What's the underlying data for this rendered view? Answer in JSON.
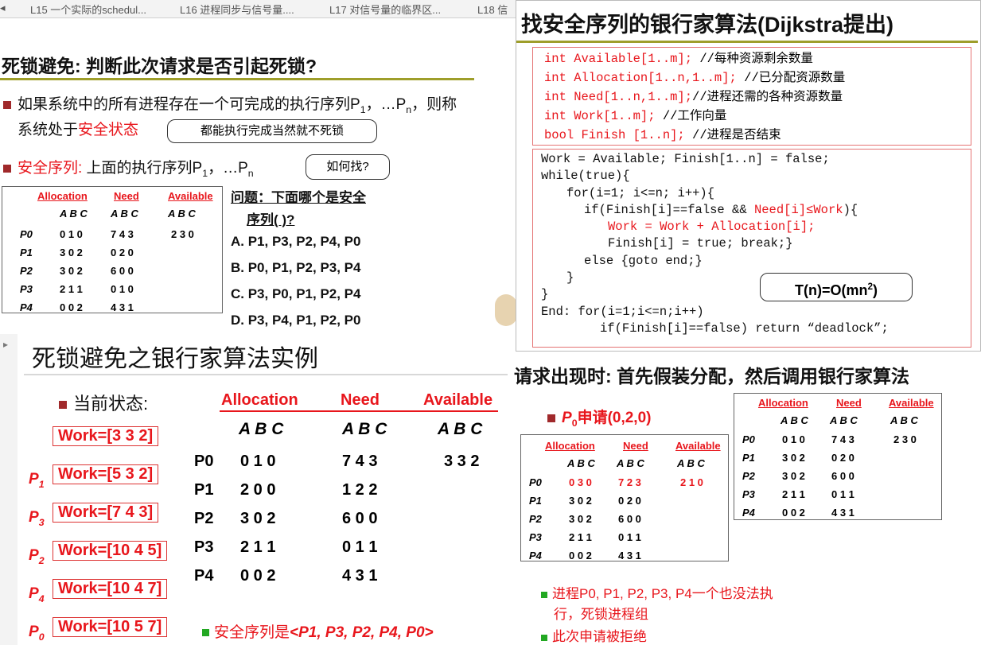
{
  "tabs": [
    {
      "label": "L15 一个实际的schedul..."
    },
    {
      "label": "L16 进程同步与信号量...."
    },
    {
      "label": "L17 对信号量的临界区..."
    },
    {
      "label": "L18 信"
    }
  ],
  "slide1": {
    "title": "死锁避免: 判断此次请求是否引起死锁?",
    "bullet1_text": "如果系统中的所有进程存在一个可完成的执行序列P",
    "bullet1_sub1": "1",
    "bullet1_mid": "，…P",
    "bullet1_subn": "n",
    "bullet1_end": "，则称",
    "bullet1_line2": "系统处于",
    "bullet1_red": "安全状态",
    "bubble1": "都能执行完成当然就不死锁",
    "bullet2_red": "安全序列:",
    "bullet2_text": " 上面的执行序列P",
    "bullet2_sub1": "1",
    "bullet2_mid": "，…P",
    "bullet2_subn": "n",
    "bubble2": "如何找?",
    "table_headers": [
      "Allocation",
      "Need",
      "Available"
    ],
    "abc": "A B C",
    "rows": [
      {
        "p": "P0",
        "alloc": "0 1 0",
        "need": "7 4 3",
        "avail": "2 3 0"
      },
      {
        "p": "P1",
        "alloc": "3 0 2",
        "need": "0 2 0",
        "avail": ""
      },
      {
        "p": "P2",
        "alloc": "3 0 2",
        "need": "6 0 0",
        "avail": ""
      },
      {
        "p": "P3",
        "alloc": "2 1 1",
        "need": "0 1 0",
        "avail": ""
      },
      {
        "p": "P4",
        "alloc": "0 0 2",
        "need": "4 3 1",
        "avail": ""
      }
    ],
    "question_line1": "问题：下面哪个是安全",
    "question_line2": "序列(  )?",
    "options": [
      "A. P1, P3, P2, P4, P0",
      "B. P0, P1, P2, P3, P4",
      "C. P3, P0, P1, P2, P4",
      "D. P3, P4, P1, P2, P0"
    ]
  },
  "slide2": {
    "title": "找安全序列的银行家算法(Dijkstra提出)",
    "decl": [
      {
        "code": "int Available[1..m];",
        "comment": " //每种资源剩余数量"
      },
      {
        "code": "int Allocation[1..n,1..m];",
        "comment": " //已分配资源数量"
      },
      {
        "code": "int Need[1..n,1..m];",
        "comment": "//进程还需的各种资源数量"
      },
      {
        "code": "int Work[1..m];",
        "comment": " //工作向量"
      },
      {
        "code": "bool Finish [1..n];",
        "comment": " //进程是否结束"
      }
    ],
    "code1": "Work = Available; Finish[1..n] = false;",
    "code2": "while(true){",
    "code3": "for(i=1; i<=n; i++){",
    "code4a": "if(Finish[i]==false && ",
    "code4b": "Need[i]≤Work",
    "code4c": "){",
    "code5": "Work = Work + Allocation[i];",
    "code6": "Finish[i] = true; break;}",
    "code7": "else {goto end;}",
    "code8": "}",
    "code9": "}",
    "code10": "End: for(i=1;i<=n;i++)",
    "code11": "if(Finish[i]==false) return “deadlock”;",
    "complexity": "T(n)=O(mn",
    "complexity_sup": "2",
    "complexity_end": ")"
  },
  "slide3": {
    "title": "死锁避免之银行家算法实例",
    "bullet": "当前状态:",
    "headers": [
      "Allocation",
      "Need",
      "Available"
    ],
    "abc": "A B C",
    "rows": [
      {
        "p": "P0",
        "alloc": "0 1 0",
        "need": "7 4 3",
        "avail": "3 3 2"
      },
      {
        "p": "P1",
        "alloc": "2 0 0",
        "need": "1 2 2",
        "avail": ""
      },
      {
        "p": "P2",
        "alloc": "3 0 2",
        "need": "6 0 0",
        "avail": ""
      },
      {
        "p": "P3",
        "alloc": "2 1 1",
        "need": "0 1 1",
        "avail": ""
      },
      {
        "p": "P4",
        "alloc": "0 0 2",
        "need": "4 3 1",
        "avail": ""
      }
    ],
    "works": [
      {
        "p": "",
        "sub": "",
        "text": "Work=[3  3  2]"
      },
      {
        "p": "P",
        "sub": "1",
        "text": "Work=[5  3  2]"
      },
      {
        "p": "P",
        "sub": "3",
        "text": "Work=[7  4  3]"
      },
      {
        "p": "P",
        "sub": "2",
        "text": "Work=[10  4  5]"
      },
      {
        "p": "P",
        "sub": "4",
        "text": "Work=[10  4  7]"
      },
      {
        "p": "P",
        "sub": "0",
        "text": "Work=[10  5  7]"
      }
    ],
    "safe_seq_label": "安全序列是",
    "safe_seq": "<P1, P3, P2, P4, P0>"
  },
  "slide4": {
    "title": "请求出现时: 首先假装分配，然后调用银行家算法",
    "request_pre": "P",
    "request_sub": "0",
    "request_text": "申请(0,2,0)",
    "headers": [
      "Allocation",
      "Need",
      "Available"
    ],
    "abc": "A B C",
    "rows_left": [
      {
        "p": "P0",
        "alloc": "0 3 0",
        "need": "7 2 3",
        "avail": "2 1 0"
      },
      {
        "p": "P1",
        "alloc": "3 0 2",
        "need": "0 2 0",
        "avail": ""
      },
      {
        "p": "P2",
        "alloc": "3 0 2",
        "need": "6 0 0",
        "avail": ""
      },
      {
        "p": "P3",
        "alloc": "2 1 1",
        "need": "0 1 1",
        "avail": ""
      },
      {
        "p": "P4",
        "alloc": "0 0 2",
        "need": "4 3 1",
        "avail": ""
      }
    ],
    "rows_right": [
      {
        "p": "P0",
        "alloc": "0 1 0",
        "need": "7 4 3",
        "avail": "2 3 0"
      },
      {
        "p": "P1",
        "alloc": "3 0 2",
        "need": "0 2 0",
        "avail": ""
      },
      {
        "p": "P2",
        "alloc": "3 0 2",
        "need": "6 0 0",
        "avail": ""
      },
      {
        "p": "P3",
        "alloc": "2 1 1",
        "need": "0 1 1",
        "avail": ""
      },
      {
        "p": "P4",
        "alloc": "0 0 2",
        "need": "4 3 1",
        "avail": ""
      }
    ],
    "conclusion1": "进程P0, P1, P2, P3, P4一个也没法执",
    "conclusion1b": "行，死锁进程组",
    "conclusion2": "此次申请被拒绝"
  },
  "colors": {
    "accent_red": "#e8161c",
    "bullet": "#a0292b",
    "green": "#22a822",
    "olive_rule": "#9e9e2a"
  }
}
